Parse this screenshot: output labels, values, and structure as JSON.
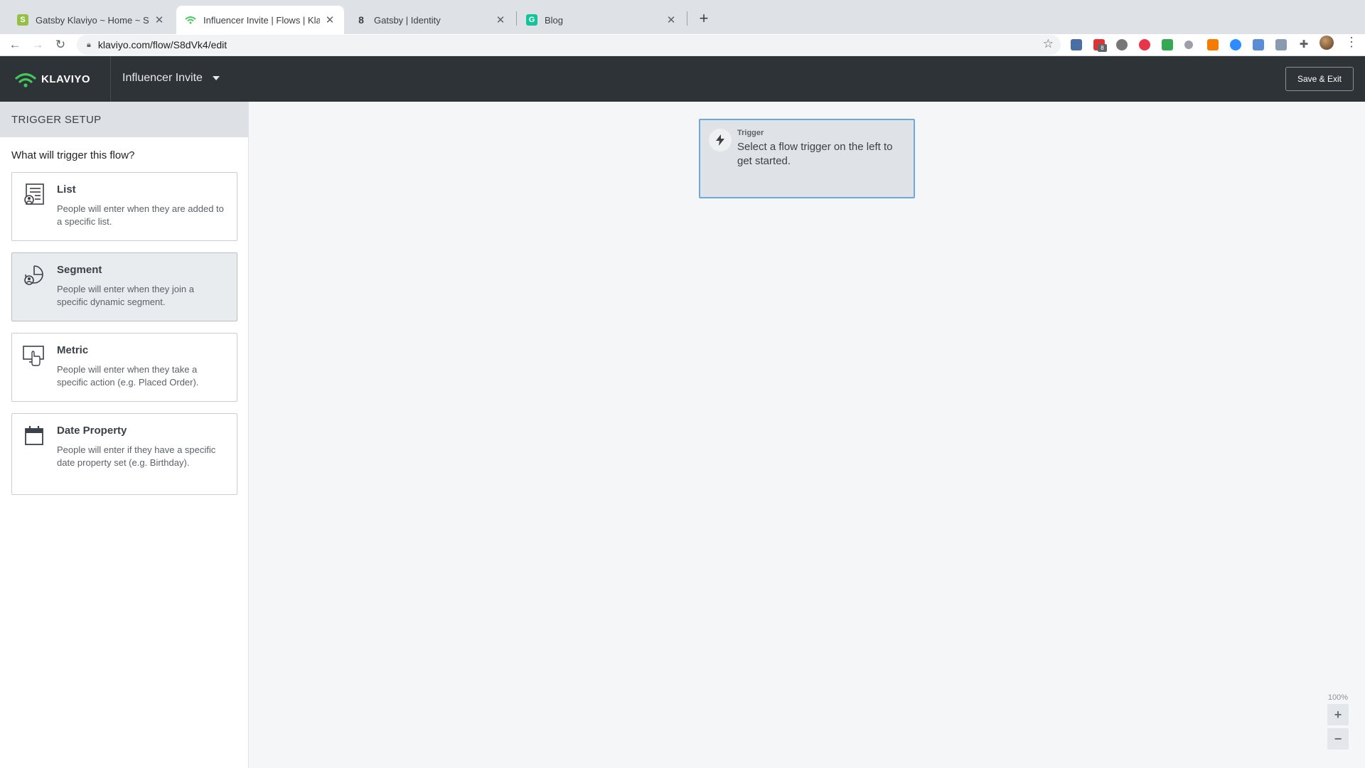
{
  "browser": {
    "tabs": [
      {
        "title": "Gatsby Klaviyo ~ Home ~ Shop",
        "favicon": "shopify-icon"
      },
      {
        "title": "Influencer Invite | Flows | Klavi",
        "favicon": "klaviyo-icon",
        "active": true
      },
      {
        "title": "Gatsby | Identity",
        "favicon": "identity-icon"
      },
      {
        "title": "Blog",
        "favicon": "grammarly-icon"
      }
    ],
    "url": "klaviyo.com/flow/S8dVk4/edit",
    "extension_badge": "8"
  },
  "header": {
    "logo_text": "KLAVIYO",
    "flow_name": "Influencer Invite",
    "save_exit_label": "Save & Exit"
  },
  "sidebar": {
    "heading": "TRIGGER SETUP",
    "question": "What will trigger this flow?",
    "options": [
      {
        "title": "List",
        "description": "People will enter when they are added to a specific list.",
        "icon": "list-icon"
      },
      {
        "title": "Segment",
        "description": "People will enter when they join a specific dynamic segment.",
        "icon": "segment-icon",
        "selected": true
      },
      {
        "title": "Metric",
        "description": "People will enter when they take a specific action (e.g. Placed Order).",
        "icon": "metric-icon"
      },
      {
        "title": "Date Property",
        "description": "People will enter if they have a specific date property set (e.g. Birthday).",
        "icon": "calendar-icon"
      }
    ]
  },
  "canvas": {
    "trigger_label": "Trigger",
    "trigger_text": "Select a flow trigger on the left to get started.",
    "zoom": "100%",
    "zoom_in": "+",
    "zoom_out": "−"
  },
  "colors": {
    "header_bg": "#2e3338",
    "brand_green": "#44c75b",
    "trigger_border": "#6fa8dc"
  }
}
